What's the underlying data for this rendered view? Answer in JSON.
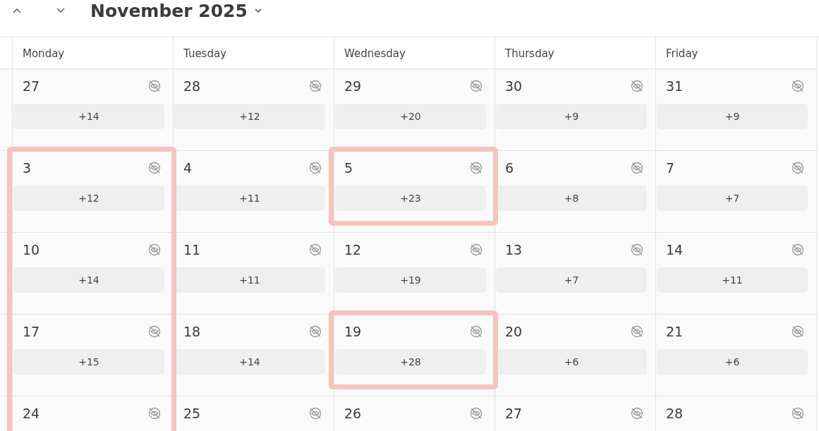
{
  "header": {
    "title": "November 2025"
  },
  "weekdays": [
    "Monday",
    "Tuesday",
    "Wednesday",
    "Thursday",
    "Friday"
  ],
  "weeks": [
    [
      {
        "day": "27",
        "more": "+14",
        "marked": false
      },
      {
        "day": "28",
        "more": "+12",
        "marked": false
      },
      {
        "day": "29",
        "more": "+20",
        "marked": false
      },
      {
        "day": "30",
        "more": "+9",
        "marked": false
      },
      {
        "day": "31",
        "more": "+9",
        "marked": false
      }
    ],
    [
      {
        "day": "3",
        "more": "+12",
        "marked": true
      },
      {
        "day": "4",
        "more": "+11",
        "marked": false
      },
      {
        "day": "5",
        "more": "+23",
        "marked": true
      },
      {
        "day": "6",
        "more": "+8",
        "marked": false
      },
      {
        "day": "7",
        "more": "+7",
        "marked": false
      }
    ],
    [
      {
        "day": "10",
        "more": "+14",
        "marked": true
      },
      {
        "day": "11",
        "more": "+11",
        "marked": false
      },
      {
        "day": "12",
        "more": "+19",
        "marked": false
      },
      {
        "day": "13",
        "more": "+7",
        "marked": false
      },
      {
        "day": "14",
        "more": "+11",
        "marked": false
      }
    ],
    [
      {
        "day": "17",
        "more": "+15",
        "marked": true
      },
      {
        "day": "18",
        "more": "+14",
        "marked": false
      },
      {
        "day": "19",
        "more": "+28",
        "marked": true
      },
      {
        "day": "20",
        "more": "+6",
        "marked": false
      },
      {
        "day": "21",
        "more": "+6",
        "marked": false
      }
    ],
    [
      {
        "day": "24",
        "marked": true
      },
      {
        "day": "25",
        "marked": false
      },
      {
        "day": "26",
        "marked": false
      },
      {
        "day": "27",
        "marked": false
      },
      {
        "day": "28",
        "marked": false
      }
    ]
  ]
}
